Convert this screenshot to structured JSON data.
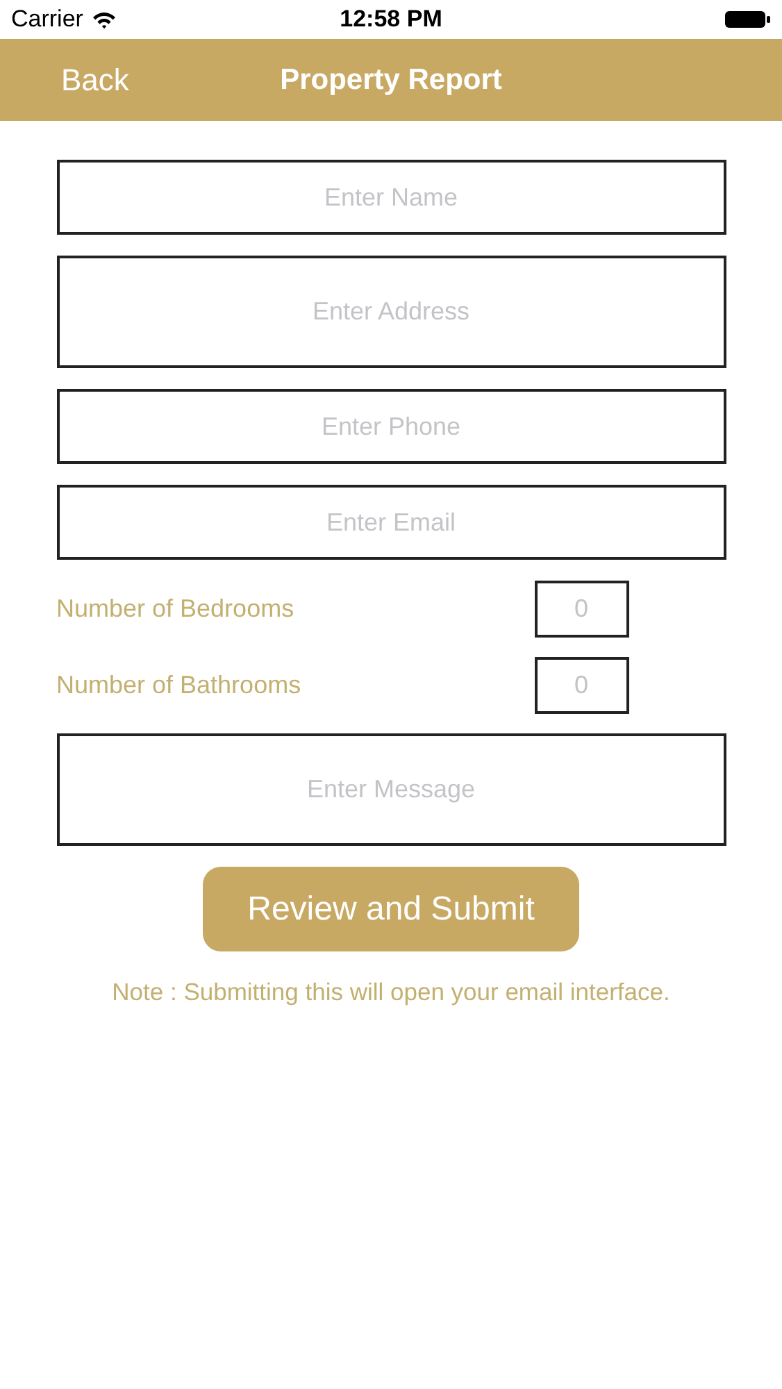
{
  "status_bar": {
    "carrier": "Carrier",
    "time": "12:58 PM"
  },
  "nav_bar": {
    "back": "Back",
    "title": "Property Report"
  },
  "fields": [
    {
      "kind": "text",
      "placeholder": "Enter Name"
    },
    {
      "kind": "tall",
      "placeholder": "Enter Address"
    },
    {
      "kind": "text",
      "placeholder": "Enter Phone"
    },
    {
      "kind": "text",
      "placeholder": "Enter Email"
    }
  ],
  "counts": [
    {
      "label": "Number of Bedrooms",
      "placeholder": "0"
    },
    {
      "label": "Number of Bathrooms",
      "placeholder": "0"
    }
  ],
  "message": {
    "placeholder": "Enter Message"
  },
  "submit_button": "Review and Submit",
  "note": "Note : Submitting this will open your email interface."
}
